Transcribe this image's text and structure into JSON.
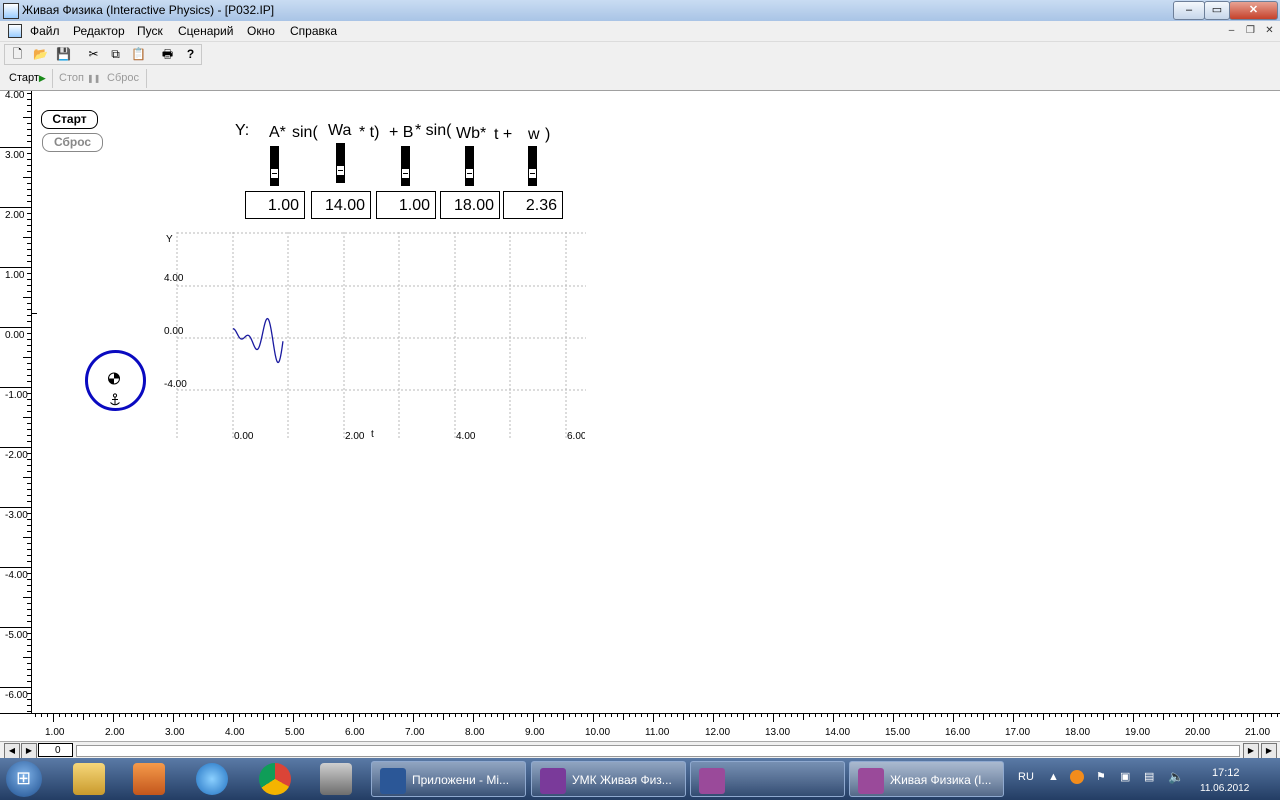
{
  "window": {
    "title": "Живая Физика (Interactive Physics) - [P032.IP]",
    "min_glyph": "–",
    "max_glyph": "▭",
    "close_glyph": "✕"
  },
  "menu": {
    "items": [
      "Файл",
      "Редактор",
      "Пуск",
      "Сценарий",
      "Окно",
      "Справка"
    ],
    "mdi_min": "–",
    "mdi_restore": "❐",
    "mdi_close": "✕"
  },
  "toolbar": {
    "icons": [
      "new-file-icon",
      "open-folder-icon",
      "save-icon",
      "cut-icon",
      "copy-icon",
      "paste-icon",
      "print-icon",
      "help-icon"
    ],
    "glyphs": [
      "🗋",
      "📂",
      "💾",
      "✂",
      "⧉",
      "📋",
      "🖶",
      "?"
    ]
  },
  "runbar": {
    "start": "Старт",
    "start_glyph": "▶",
    "stop": "Стоп",
    "stop_glyph": "❚❚",
    "reset": "Сброс"
  },
  "scene": {
    "start_button": "Старт",
    "reset_button": "Сброс",
    "formula": {
      "prefix": "Y:",
      "p1": "A*",
      "p2": "sin(",
      "p3": "Wa",
      "p4": "* t)",
      "p5": "+ B",
      "p6": "* sin(",
      "p7": "Wb*",
      "p8": "t +",
      "p9": "w",
      "p10": ")"
    },
    "sliders": [
      {
        "name": "A",
        "value": "1.00"
      },
      {
        "name": "Wa",
        "value": "14.00"
      },
      {
        "name": "B",
        "value": "1.00"
      },
      {
        "name": "Wb",
        "value": "18.00"
      },
      {
        "name": "w",
        "value": "2.36"
      }
    ],
    "graph": {
      "y_label": "Y",
      "x_label": "t",
      "y_ticks": [
        "4.00",
        "0.00",
        "-4.00"
      ],
      "x_ticks": [
        "0.00",
        "2.00",
        "4.00",
        "6.00"
      ],
      "line_color": "#1a1aa0"
    },
    "body": {
      "color": "#0a0ac0"
    }
  },
  "vruler": {
    "labels": [
      "4.00",
      "3.00",
      "2.00",
      "1.00",
      "0.00",
      "-1.00",
      "-2.00",
      "-3.00",
      "-4.00",
      "-5.00",
      "-6.00"
    ]
  },
  "hruler": {
    "labels": [
      "1.00",
      "2.00",
      "3.00",
      "4.00",
      "5.00",
      "6.00",
      "7.00",
      "8.00",
      "9.00",
      "10.00",
      "11.00",
      "12.00",
      "13.00",
      "14.00",
      "15.00",
      "16.00",
      "17.00",
      "18.00",
      "19.00",
      "20.00",
      "21.00"
    ]
  },
  "frame_counter": "0",
  "taskbar": {
    "buttons": [
      {
        "label": "Приложени - Mi...",
        "color": "#2b5797"
      },
      {
        "label": "УМК Живая Физ...",
        "color": "#7a3a9a"
      },
      {
        "label": "",
        "color": "#9a4a9a"
      },
      {
        "label": "Живая Физика (I...",
        "color": "#9a4a9a"
      }
    ],
    "lang": "RU",
    "time": "17:12",
    "date": "11.06.2012"
  }
}
